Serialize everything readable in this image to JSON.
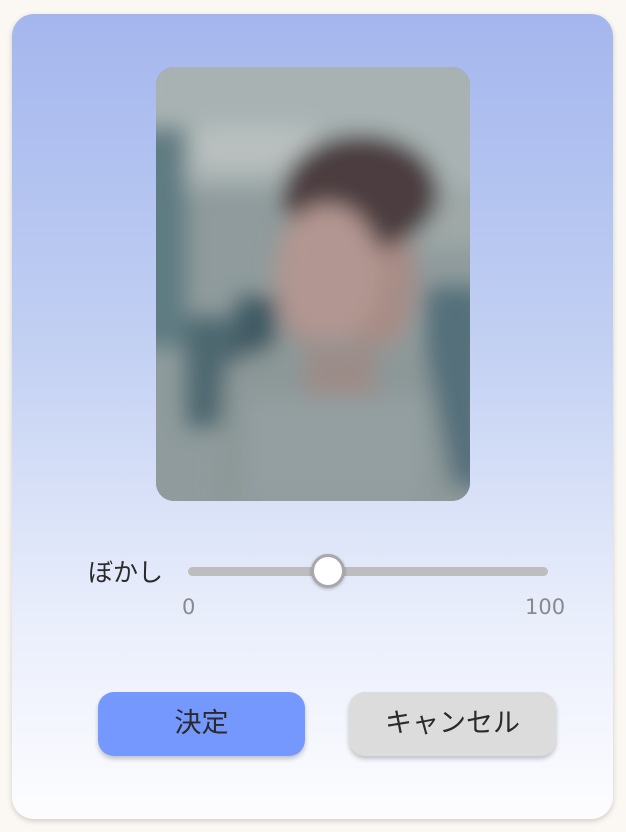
{
  "dialog": {
    "photo_alt": "ぼかした写真プレビュー",
    "slider": {
      "label": "ぼかし",
      "min_label": "0",
      "max_label": "100",
      "value": 39
    },
    "buttons": {
      "confirm_label": "決定",
      "cancel_label": "キャンセル"
    }
  },
  "colors": {
    "confirm_button": "#7598ff",
    "cancel_button": "#dcdcdc",
    "track": "#bdbdbf",
    "dialog_top": "#a4b6ee",
    "dialog_bottom": "#fdfdff"
  }
}
